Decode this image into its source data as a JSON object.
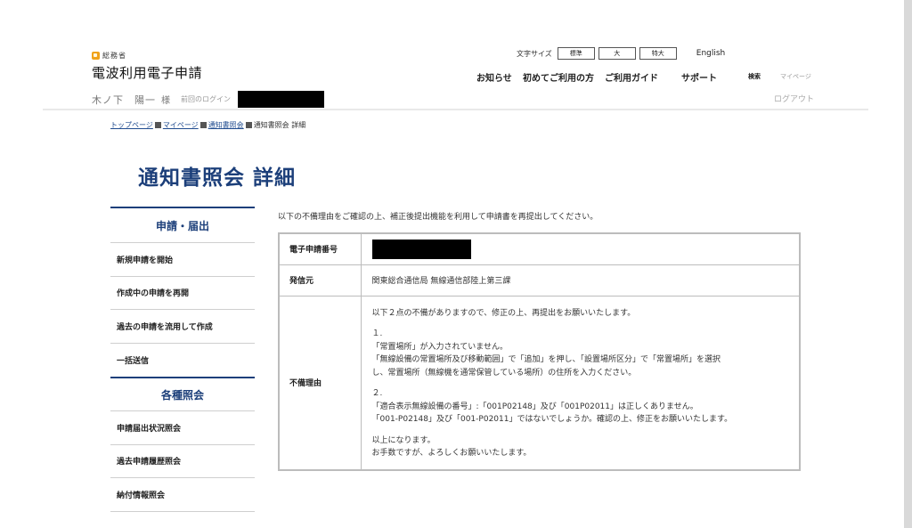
{
  "header": {
    "ministry": "総務省",
    "site_title": "電波利用電子申請",
    "user_name": "木ノ下　陽一",
    "user_suffix": "様",
    "last_login_label": "前回のログイン",
    "font_size_label": "文字サイズ",
    "font_sizes": [
      "標準",
      "大",
      "特大"
    ],
    "language_link": "English",
    "nav": {
      "news": "お知らせ",
      "first_time": "初めてご利用の方",
      "guide": "ご利用ガイド",
      "support": "サポート",
      "search": "検索",
      "mypage": "マイページ",
      "logout": "ログアウト"
    }
  },
  "breadcrumb": {
    "top": "トップページ",
    "mypage": "マイページ",
    "notice": "通知書照会",
    "current": "通知書照会 詳細"
  },
  "page_title": "通知書照会 詳細",
  "sidebar": {
    "section1_title": "申請・届出",
    "section1_items": [
      "新規申請を開始",
      "作成中の申請を再開",
      "過去の申請を流用して作成",
      "一括送信"
    ],
    "section2_title": "各種照会",
    "section2_items": [
      "申請届出状況照会",
      "過去申請履歴照会",
      "納付情報照会"
    ]
  },
  "main": {
    "intro": "以下の不備理由をご確認の上、補正後提出機能を利用して申請書を再提出してください。",
    "labels": {
      "application_number": "電子申請番号",
      "sender": "発信元",
      "reason": "不備理由"
    },
    "sender_value": "関東総合通信局 無線通信部陸上第三課",
    "reason_lines": {
      "l1": "以下２点の不備がありますので、修正の上、再提出をお願いいたします。",
      "n1": "１.",
      "l2": "「常置場所」が入力されていません。",
      "l3": "「無線設備の常置場所及び移動範囲」で「追加」を押し、「設置場所区分」で「常置場所」を選択",
      "l4": "し、常置場所（無線機を通常保管している場所）の住所を入力ください。",
      "n2": "２.",
      "l5": "「適合表示無線設備の番号」:「001P02148」及び「001P02011」は正しくありません。",
      "l6": "「001-P02148」及び「001-P02011」ではないでしょうか。確認の上、修正をお願いいたします。",
      "l7": "以上になります。",
      "l8": "お手数ですが、よろしくお願いいたします。"
    }
  }
}
